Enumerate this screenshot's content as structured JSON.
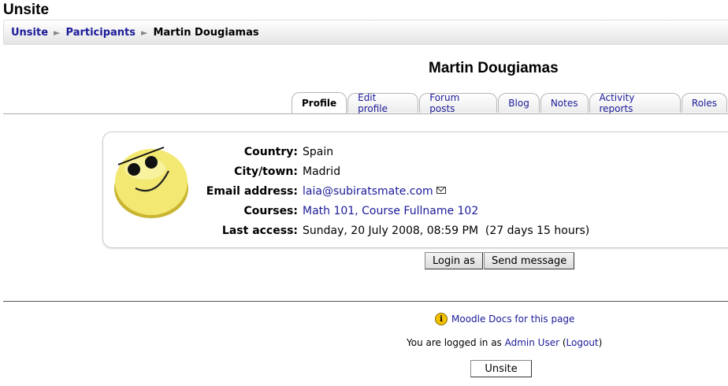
{
  "site": {
    "title": "Unsite"
  },
  "breadcrumb": {
    "home": "Unsite",
    "participants": "Participants",
    "current": "Martin Dougiamas",
    "separator": "►"
  },
  "profile": {
    "name": "Martin Dougiamas",
    "tabs": [
      "Profile",
      "Edit profile",
      "Forum posts",
      "Blog",
      "Notes",
      "Activity reports",
      "Roles"
    ],
    "active_tab": "Profile",
    "avatar_icon": "smiley-sunglasses-icon",
    "fields": {
      "country_label": "Country:",
      "country": "Spain",
      "city_label": "City/town:",
      "city": "Madrid",
      "email_label": "Email address:",
      "email": "laia@subiratsmate.com",
      "courses_label": "Courses:",
      "course1": "Math 101",
      "course_sep": ", ",
      "course2": "Course Fullname 102",
      "last_access_label": "Last access:",
      "last_access": "Sunday, 20 July 2008, 08:59 PM  (27 days 15 hours)"
    },
    "buttons": {
      "login_as": "Login as",
      "send_message": "Send message"
    }
  },
  "footer": {
    "docs_link": "Moodle Docs for this page",
    "logged_in_prefix": "You are logged in as ",
    "user": "Admin User",
    "logout": "Logout",
    "home_button": "Unsite"
  }
}
